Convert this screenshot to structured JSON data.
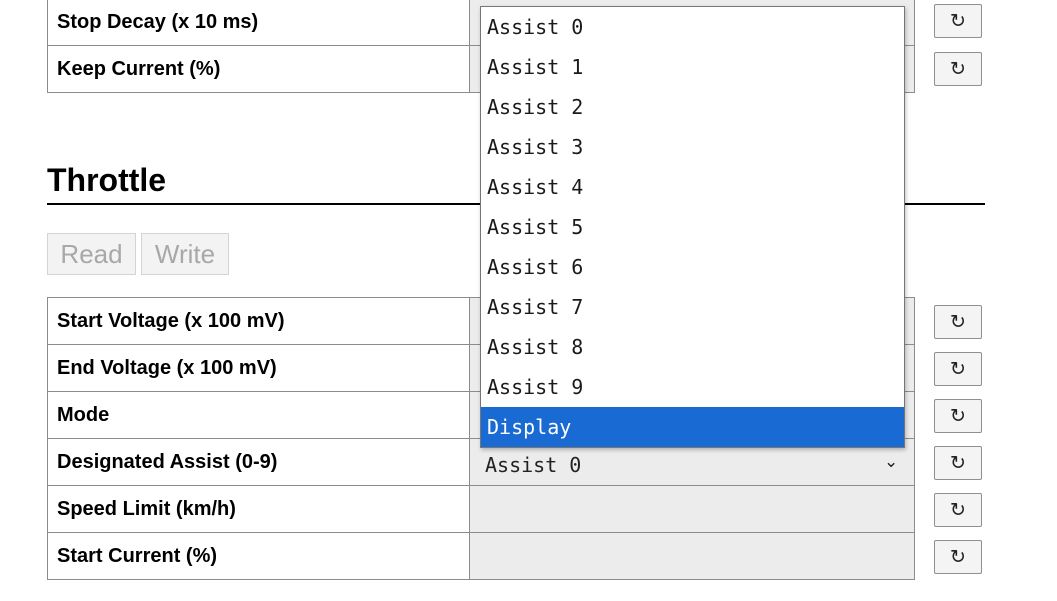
{
  "top_rows": [
    {
      "label": "Stop Decay (x 10 ms)",
      "reset_icon": "refresh-icon"
    },
    {
      "label": "Keep Current (%)",
      "reset_icon": "refresh-icon"
    }
  ],
  "throttle": {
    "title": "Throttle",
    "read_label": "Read",
    "write_label": "Write",
    "rows": [
      {
        "label": "Start Voltage (x 100 mV)",
        "reset_icon": "refresh-icon"
      },
      {
        "label": "End Voltage (x 100 mV)",
        "reset_icon": "refresh-icon"
      },
      {
        "label": "Mode",
        "reset_icon": "refresh-icon"
      },
      {
        "label": "Designated Assist (0-9)",
        "reset_icon": "refresh-icon",
        "value": "Assist 0"
      },
      {
        "label": "Speed Limit (km/h)",
        "reset_icon": "refresh-icon"
      },
      {
        "label": "Start Current (%)",
        "reset_icon": "refresh-icon"
      }
    ]
  },
  "icons": {
    "reset": "↻",
    "chevron": "⌄"
  },
  "dropdown": {
    "options": [
      "Assist 0",
      "Assist 1",
      "Assist 2",
      "Assist 3",
      "Assist 4",
      "Assist 5",
      "Assist 6",
      "Assist 7",
      "Assist 8",
      "Assist 9",
      "Display"
    ],
    "highlighted": "Display"
  },
  "colors": {
    "highlight": "#1a6ad3",
    "field_bg": "#ececec",
    "disabled_text": "#a8a8a8"
  }
}
